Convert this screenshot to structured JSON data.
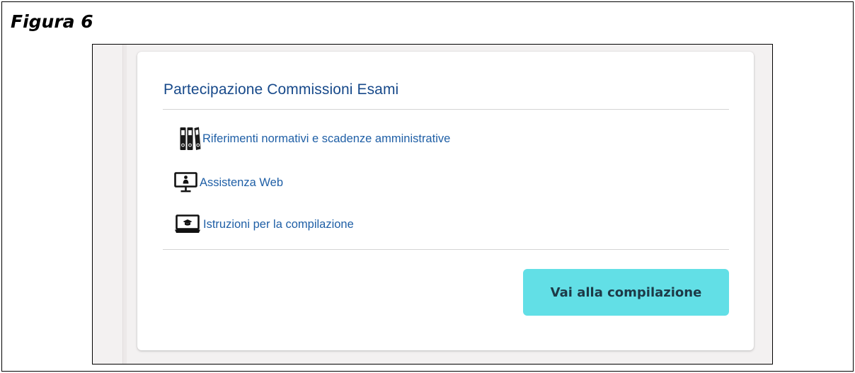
{
  "figure": {
    "title": "Figura 6"
  },
  "card": {
    "title": "Partecipazione Commissioni Esami",
    "links": [
      {
        "label": "Riferimenti normativi e scadenze amministrative",
        "icon": "binders-icon"
      },
      {
        "label": "Assistenza Web",
        "icon": "monitor-user-icon"
      },
      {
        "label": "Istruzioni per la compilazione",
        "icon": "laptop-graduation-icon"
      }
    ],
    "cta_label": "Vai alla compilazione"
  },
  "colors": {
    "title_blue": "#17498a",
    "link_blue": "#1f5fa6",
    "button_cyan": "#62dfe6",
    "button_text": "#1d3a47"
  }
}
